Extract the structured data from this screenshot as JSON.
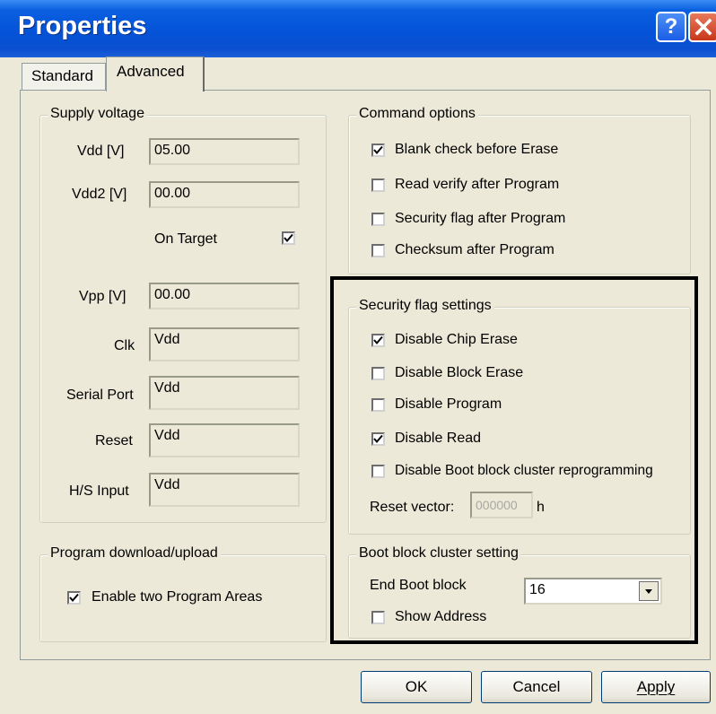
{
  "window": {
    "title": "Properties",
    "help": "?",
    "close": "X"
  },
  "tabs": [
    {
      "label": "Standard"
    },
    {
      "label": "Advanced"
    }
  ],
  "supply": {
    "title": "Supply voltage",
    "vdd": {
      "label": "Vdd [V]",
      "value": "05.00"
    },
    "vdd2": {
      "label": "Vdd2 [V]",
      "value": "00.00"
    },
    "on_target": {
      "label": "On Target",
      "checked": true
    },
    "vpp": {
      "label": "Vpp [V]",
      "value": "00.00"
    },
    "clk": {
      "label": "Clk",
      "value": "Vdd"
    },
    "serial": {
      "label": "Serial Port",
      "value": "Vdd"
    },
    "reset": {
      "label": "Reset",
      "value": "Vdd"
    },
    "hs": {
      "label": "H/S Input",
      "value": "Vdd"
    }
  },
  "program": {
    "title": "Program download/upload",
    "enable_two": {
      "label": "Enable two Program Areas",
      "checked": true
    }
  },
  "command": {
    "title": "Command options",
    "options": [
      {
        "label": "Blank check before Erase",
        "checked": true
      },
      {
        "label": "Read verify after Program",
        "checked": false
      },
      {
        "label": "Security flag after Program",
        "checked": false
      },
      {
        "label": "Checksum after Program",
        "checked": false
      }
    ]
  },
  "security": {
    "title": "Security flag settings",
    "options": [
      {
        "label": "Disable Chip Erase",
        "checked": true
      },
      {
        "label": "Disable Block Erase",
        "checked": false
      },
      {
        "label": "Disable Program",
        "checked": false
      },
      {
        "label": "Disable Read",
        "checked": true
      },
      {
        "label": "Disable Boot block cluster reprogramming",
        "checked": false
      }
    ],
    "reset_vector": {
      "label": "Reset vector:",
      "value": "000000",
      "suffix": "h"
    }
  },
  "boot": {
    "title": "Boot block cluster setting",
    "end_label": "End Boot block",
    "end_value": "16",
    "show_address": {
      "label": "Show Address",
      "checked": false
    }
  },
  "buttons": {
    "ok": "OK",
    "cancel": "Cancel",
    "apply": "Apply"
  },
  "colors": {
    "titlebar": "#0553d8",
    "dialog_bg": "#ece9d8",
    "close": "#c8371a"
  }
}
